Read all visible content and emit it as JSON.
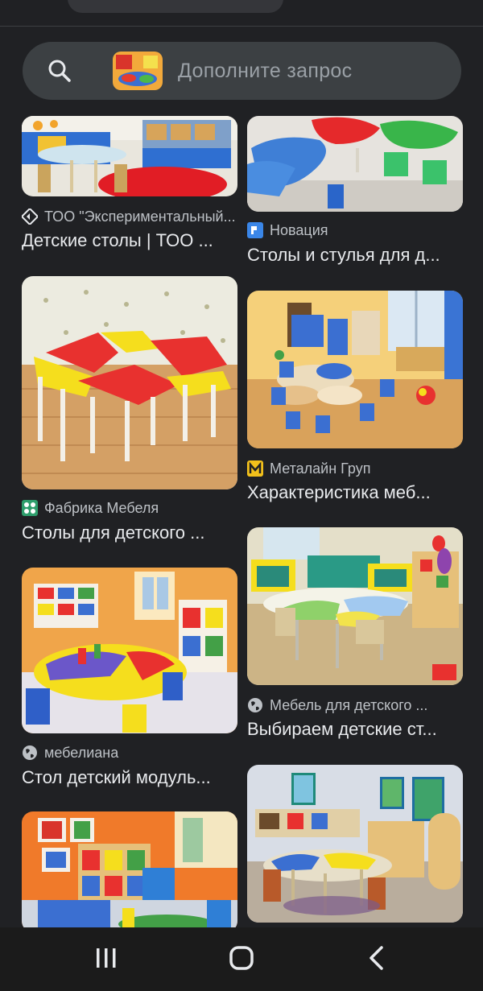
{
  "search": {
    "placeholder": "Дополните запрос"
  },
  "results": [
    {
      "source": "ТОО \"Экспериментальный...",
      "title": "Детские столы | ТОО ...",
      "favicon": "diamond-logo-icon"
    },
    {
      "source": "Новация",
      "title": "Столы и стулья для д...",
      "favicon": "novatsiya-logo-icon"
    },
    {
      "source": "Фабрика Мебеля",
      "title": "Столы для детского ...",
      "favicon": "fabrika-logo-icon"
    },
    {
      "source": "Металайн Груп",
      "title": "Характеристика меб...",
      "favicon": "m-logo-icon"
    },
    {
      "source": "мебелиана",
      "title": "Стол детский модуль...",
      "favicon": "globe-icon"
    },
    {
      "source": "Мебель для детского ...",
      "title": "Выбираем детские ст...",
      "favicon": "globe-icon"
    }
  ],
  "colors": {
    "background": "#202124",
    "search_bar": "#3c4043",
    "text": "#e8eaed",
    "muted": "#bdc1c6"
  },
  "navigation": {
    "recent_apps": "recent-apps-icon",
    "home": "home-icon",
    "back": "back-icon"
  }
}
